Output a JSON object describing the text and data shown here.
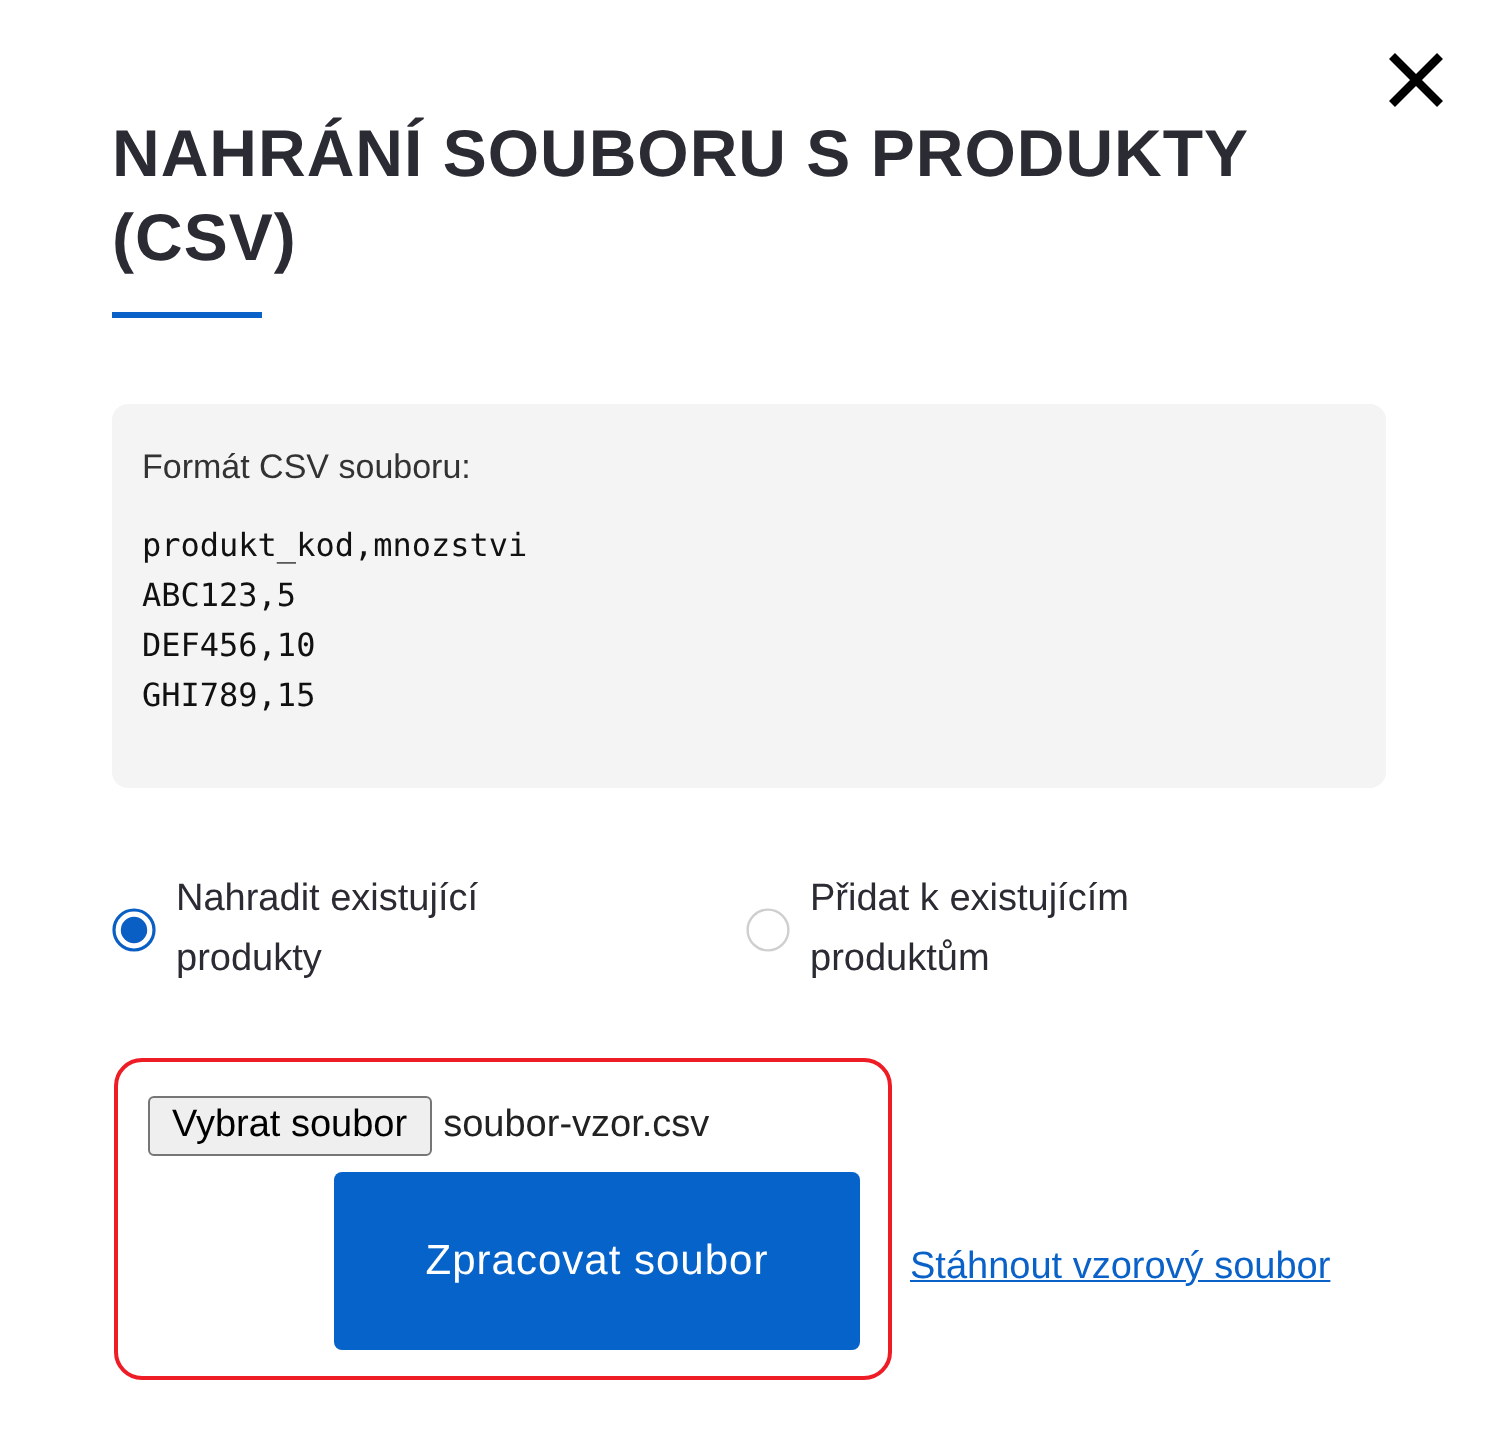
{
  "dialog": {
    "title": "NAHRÁNÍ SOUBORU S PRODUKTY (CSV)"
  },
  "format_box": {
    "heading": "Formát CSV souboru:",
    "lines": [
      "produkt_kod,mnozstvi",
      "ABC123,5",
      "DEF456,10",
      "GHI789,15"
    ]
  },
  "import_mode": [
    {
      "label": "Nahradit existující produkty",
      "selected": true
    },
    {
      "label": "Přidat k existujícím produktům",
      "selected": false
    }
  ],
  "upload": {
    "highlighted": true,
    "choose_button": "Vybrat soubor",
    "file_name": "soubor-vzor.csv",
    "submit_button": "Zpracovat soubor"
  },
  "download_link": "Stáhnout vzorový soubor"
}
